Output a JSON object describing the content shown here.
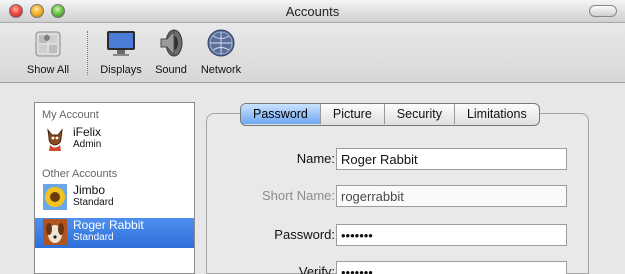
{
  "window": {
    "title": "Accounts"
  },
  "toolbar": {
    "items": [
      {
        "label": "Show All",
        "icon": "apple-prefs-icon"
      },
      {
        "label": "Displays",
        "icon": "display-icon"
      },
      {
        "label": "Sound",
        "icon": "speaker-icon"
      },
      {
        "label": "Network",
        "icon": "network-globe-icon"
      }
    ]
  },
  "accounts": {
    "my_account_header": "My Account",
    "other_accounts_header": "Other Accounts",
    "users": [
      {
        "name": "iFelix",
        "role": "Admin",
        "avatar": "cat-avatar-icon",
        "selected": false
      },
      {
        "name": "Jimbo",
        "role": "Standard",
        "avatar": "sunflower-avatar-icon",
        "selected": false
      },
      {
        "name": "Roger Rabbit",
        "role": "Standard",
        "avatar": "dog-avatar-icon",
        "selected": true
      }
    ]
  },
  "tabs": [
    "Password",
    "Picture",
    "Security",
    "Limitations"
  ],
  "active_tab": "Password",
  "form": {
    "name_label": "Name:",
    "name_value": "Roger Rabbit",
    "short_name_label": "Short Name:",
    "short_name_value": "rogerrabbit",
    "password_label": "Password:",
    "password_value": "•••••••",
    "verify_label": "Verify:",
    "verify_value": "•••••••"
  },
  "colors": {
    "selection": "#2d6fd8",
    "active_tab": "#6ea8f3"
  }
}
